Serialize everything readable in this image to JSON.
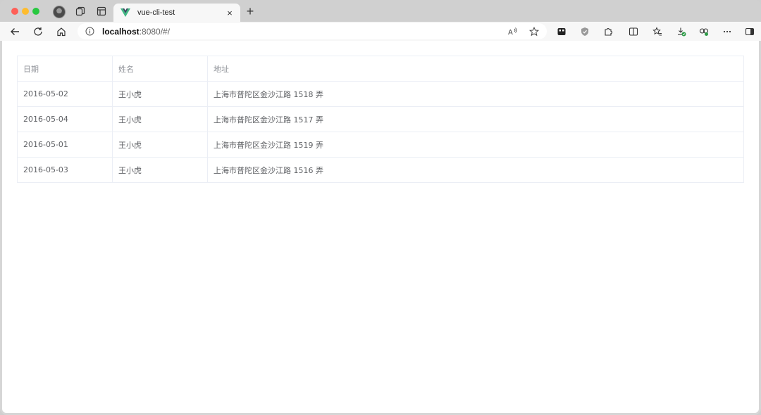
{
  "browser": {
    "tab": {
      "title": "vue-cli-test",
      "close_label": "×"
    },
    "new_tab_label": "+",
    "address": {
      "host": "localhost",
      "rest": ":8080/#/"
    },
    "icons": {
      "back": "arrow-left-icon",
      "reload": "reload-icon",
      "home": "home-icon",
      "info": "info-icon",
      "read_aloud": "read-aloud-icon",
      "favorite": "star-icon",
      "extensions": "puzzle-icon",
      "more": "more-icon"
    }
  },
  "colors": {
    "vue_green": "#41b883",
    "vue_dark": "#35495e",
    "header_text": "#909399",
    "cell_text": "#606266",
    "border": "#ebeef5"
  },
  "table": {
    "headers": {
      "date": "日期",
      "name": "姓名",
      "address": "地址"
    },
    "rows": [
      {
        "date": "2016-05-02",
        "name": "王小虎",
        "address": "上海市普陀区金沙江路 1518 弄"
      },
      {
        "date": "2016-05-04",
        "name": "王小虎",
        "address": "上海市普陀区金沙江路 1517 弄"
      },
      {
        "date": "2016-05-01",
        "name": "王小虎",
        "address": "上海市普陀区金沙江路 1519 弄"
      },
      {
        "date": "2016-05-03",
        "name": "王小虎",
        "address": "上海市普陀区金沙江路 1516 弄"
      }
    ]
  }
}
